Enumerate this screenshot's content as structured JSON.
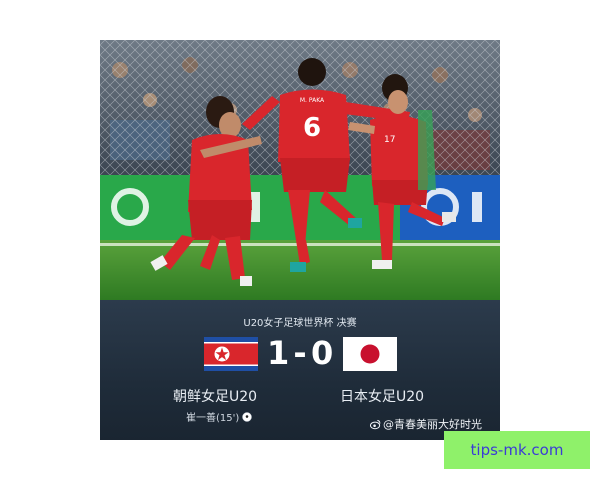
{
  "match": {
    "title": "U20女子足球世界杯 决赛",
    "home_score": "1",
    "separator": "-",
    "away_score": "0",
    "home_team": "朝鲜女足U20",
    "away_team": "日本女足U20",
    "scorer": "崔一善(15')",
    "home_flag": "north-korea-flag",
    "away_flag": "japan-flag"
  },
  "photo": {
    "jersey_number": "6",
    "shirt_lettering": "M. PAKA",
    "jersey_number_right": "17"
  },
  "watermark": {
    "weibo": "@青春美丽大好时光",
    "site": "tips-mk.com"
  },
  "colors": {
    "kit_red": "#d9262c",
    "pitch_green": "#3d8a2c",
    "board_bg": "#26333f",
    "tip_bg": "#8ff16a",
    "tip_text": "#3b3bd6"
  }
}
